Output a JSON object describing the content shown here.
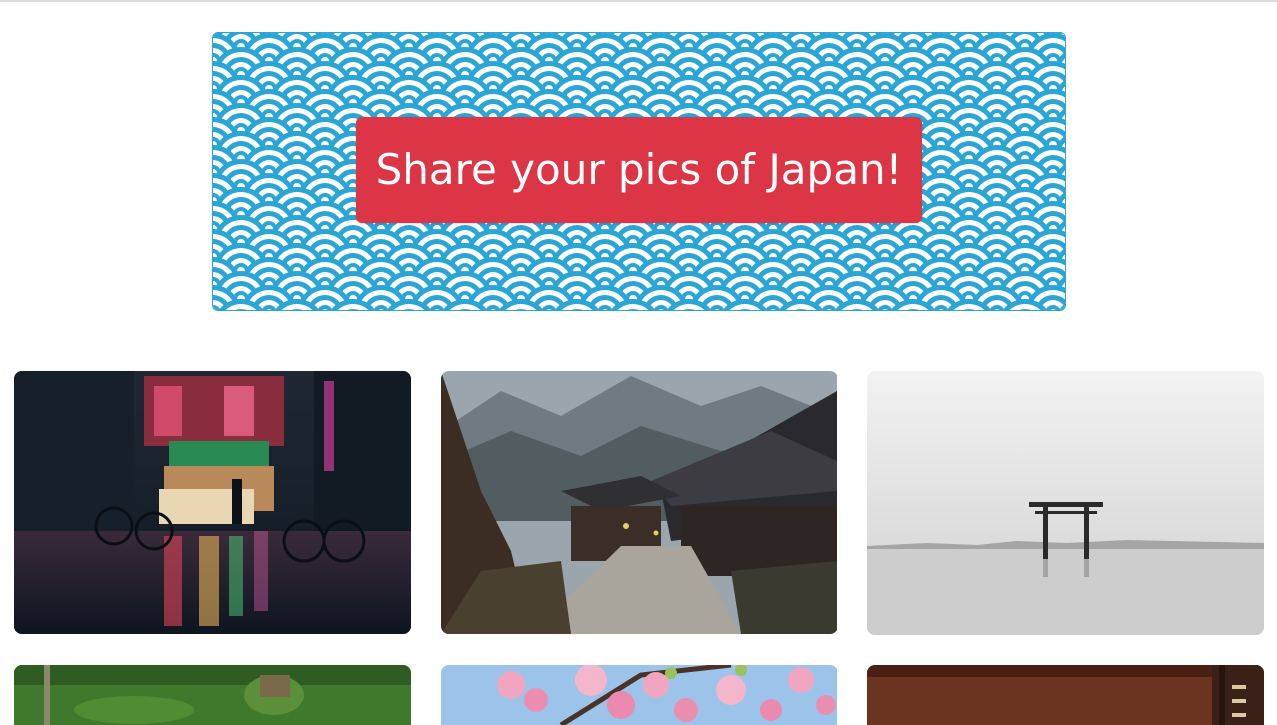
{
  "banner": {
    "cta_label": "Share your pics of Japan!",
    "pattern_icon": "seigaiha-wave-pattern",
    "colors": {
      "wave": "#2aa6d6",
      "background": "#ffffff",
      "cta": "#dc3545",
      "cta_text": "#ffffff"
    }
  },
  "gallery": {
    "photos": [
      {
        "subject": "neon-street-night"
      },
      {
        "subject": "mountain-village"
      },
      {
        "subject": "torii-gate-lake"
      },
      {
        "subject": "moss-garden"
      },
      {
        "subject": "cherry-blossoms"
      },
      {
        "subject": "shrine-wall"
      }
    ]
  }
}
